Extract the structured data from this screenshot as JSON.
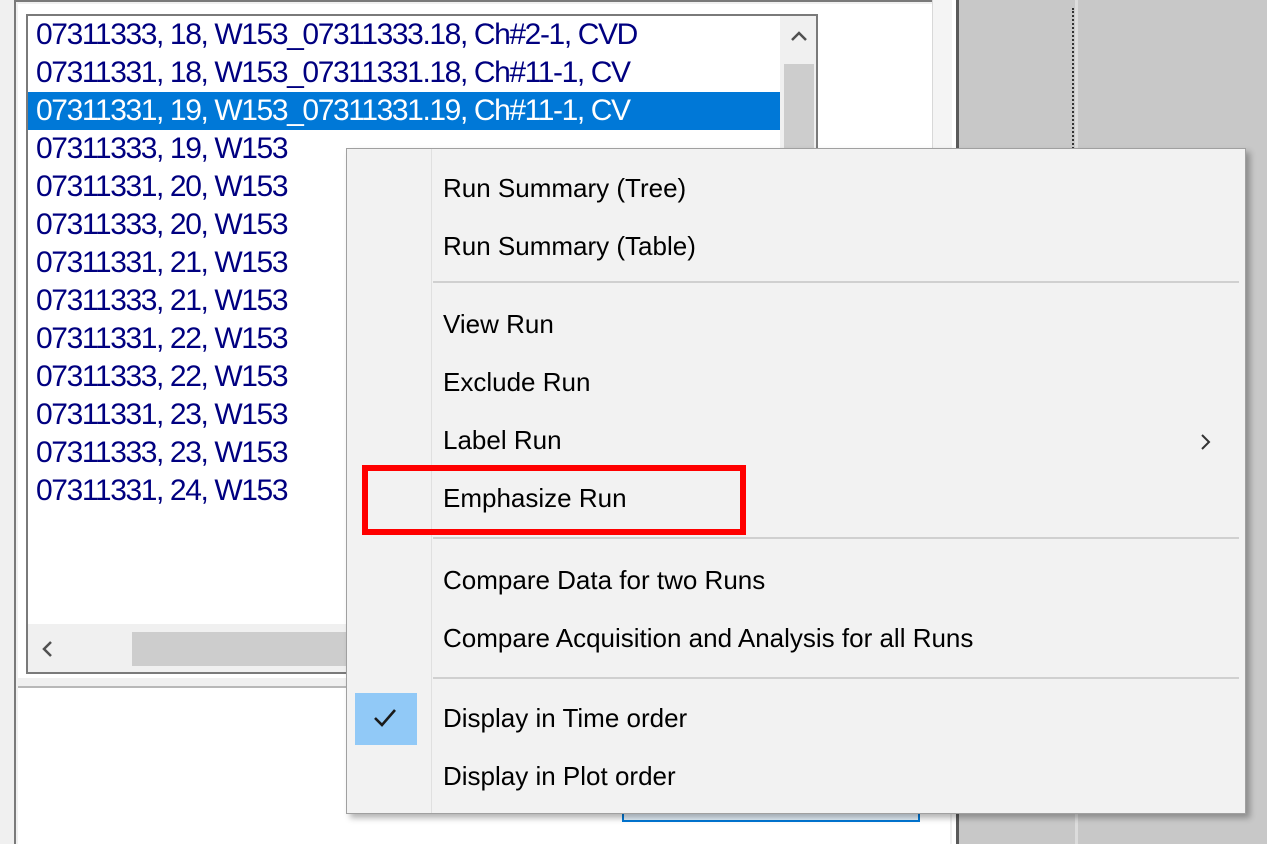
{
  "run_list": {
    "rows": [
      "07311333, 18, W153_07311333.18, Ch#2-1, CVD",
      "07311331, 18, W153_07311331.18, Ch#11-1, CV",
      "07311331, 19, W153_07311331.19, Ch#11-1, CV",
      "07311333, 19, W153",
      "07311331, 20, W153",
      "07311333, 20, W153",
      "07311331, 21, W153",
      "07311333, 21, W153",
      "07311331, 22, W153",
      "07311333, 22, W153",
      "07311331, 23, W153",
      "07311333, 23, W153",
      "07311331, 24, W153"
    ],
    "selected_index": 2
  },
  "scrollbar": {
    "up_icon": "chevron-up-icon",
    "left_icon": "chevron-left-icon"
  },
  "context_menu": {
    "groups": [
      [
        {
          "label": "Run Summary (Tree)"
        },
        {
          "label": "Run Summary (Table)"
        }
      ],
      [
        {
          "label": "View Run"
        },
        {
          "label": "Exclude Run"
        },
        {
          "label": "Label Run",
          "submenu": true
        },
        {
          "label": "Emphasize Run",
          "highlighted": true
        }
      ],
      [
        {
          "label": "Compare Data for two Runs"
        },
        {
          "label": "Compare Acquisition and Analysis for all Runs"
        }
      ],
      [
        {
          "label": "Display in Time order",
          "checked": true
        },
        {
          "label": "Display in Plot order"
        }
      ]
    ]
  },
  "colors": {
    "selection": "#0078d7",
    "list_text": "#000080",
    "check_highlight": "#91c9f7",
    "annotation": "#ff0000"
  }
}
